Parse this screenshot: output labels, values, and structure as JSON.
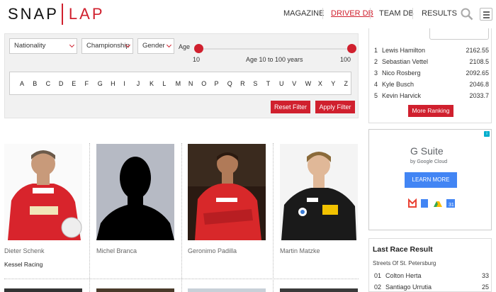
{
  "brand": {
    "left": "SNAP",
    "right": "LAP"
  },
  "nav": {
    "items": [
      {
        "label": "MAGAZINE"
      },
      {
        "label": "DRIVER DB"
      },
      {
        "label": "TEAM DB"
      },
      {
        "label": "RESULTS"
      }
    ]
  },
  "filter": {
    "nationality": "Nationality",
    "championship": "Championship",
    "gender": "Gender",
    "age_label": "Age",
    "age_min": "10",
    "age_max": "100",
    "age_range_text": "Age 10 to 100 years",
    "letters": [
      "A",
      "B",
      "C",
      "D",
      "E",
      "F",
      "G",
      "H",
      "I",
      "J",
      "K",
      "L",
      "M",
      "N",
      "O",
      "P",
      "Q",
      "R",
      "S",
      "T",
      "U",
      "V",
      "W",
      "X",
      "Y",
      "Z"
    ],
    "reset_label": "Reset Filter",
    "apply_label": "Apply Filter"
  },
  "drivers": [
    {
      "name": "Dieter Schenk",
      "team": "Kessel Racing"
    },
    {
      "name": "Michel Branca",
      "team": ""
    },
    {
      "name": "Geronimo Padilla",
      "team": ""
    },
    {
      "name": "Martin Matzke",
      "team": ""
    }
  ],
  "ranking": {
    "rows": [
      {
        "pos": "1",
        "name": "Lewis Hamilton",
        "points": "2162.55"
      },
      {
        "pos": "2",
        "name": "Sebastian Vettel",
        "points": "2108.5"
      },
      {
        "pos": "3",
        "name": "Nico Rosberg",
        "points": "2092.65"
      },
      {
        "pos": "4",
        "name": "Kyle Busch",
        "points": "2046.8"
      },
      {
        "pos": "5",
        "name": "Kevin Harvick",
        "points": "2033.7"
      }
    ],
    "more_label": "More Ranking"
  },
  "ad": {
    "title": "G Suite",
    "subtitle": "by Google Cloud",
    "cta": "LEARN MORE",
    "info": "i"
  },
  "last_race": {
    "title": "Last Race Result",
    "event": "Streets Of St. Petersburg",
    "rows": [
      {
        "pos": "01",
        "name": "Colton Herta",
        "points": "33"
      },
      {
        "pos": "02",
        "name": "Santiago Urrutia",
        "points": "25"
      }
    ]
  },
  "colors": {
    "accent": "#d0202e",
    "ad_blue": "#4285f4"
  }
}
